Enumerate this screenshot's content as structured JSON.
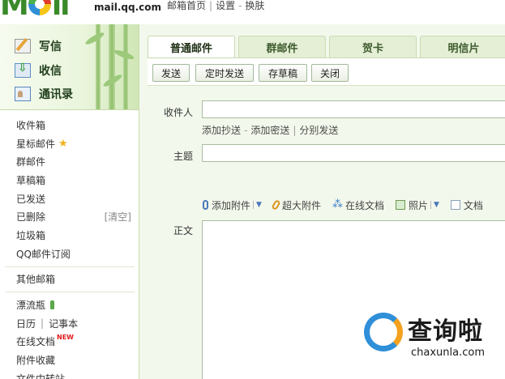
{
  "header": {
    "domain": "mail.qq.com",
    "nav": [
      "邮箱首页",
      "设置",
      "换肤"
    ]
  },
  "sidebar": {
    "actions": [
      {
        "label": "写信",
        "icon": "write-icon"
      },
      {
        "label": "收信",
        "icon": "inbox-icon"
      },
      {
        "label": "通讯录",
        "icon": "contacts-icon"
      }
    ],
    "folders": [
      "收件箱",
      "星标邮件",
      "群邮件",
      "草稿箱",
      "已发送",
      "已删除",
      "垃圾箱",
      "QQ邮件订阅"
    ],
    "deleted_clear": "[清空]",
    "other_mailbox": "其他邮箱",
    "drift_bottle": "漂流瓶",
    "calendar": "日历",
    "notepad": "记事本",
    "online_docs": "在线文档",
    "new_badge": "NEW",
    "attachments": "附件收藏",
    "file_transfer": "文件中转站"
  },
  "tabs": [
    "普通邮件",
    "群邮件",
    "贺卡",
    "明信片"
  ],
  "toolbar": {
    "send": "发送",
    "scheduled_send": "定时发送",
    "save_draft": "存草稿",
    "close": "关闭"
  },
  "compose": {
    "to_label": "收件人",
    "to_value": "",
    "cc_link": "添加抄送",
    "bcc_link": "添加密送",
    "separate_link": "分别发送",
    "subject_label": "主题",
    "subject_value": "",
    "add_attachment": "添加附件",
    "big_attachment": "超大附件",
    "online_doc": "在线文档",
    "photo": "照片",
    "document": "文档",
    "body_label": "正文",
    "body_value": ""
  },
  "watermark": {
    "text": "查询啦",
    "url": "chaxunla.com"
  },
  "colors": {
    "accent_green": "#3a8a2a",
    "tab_bg": "#e4efd6",
    "panel_bg": "#f3f8ec"
  }
}
